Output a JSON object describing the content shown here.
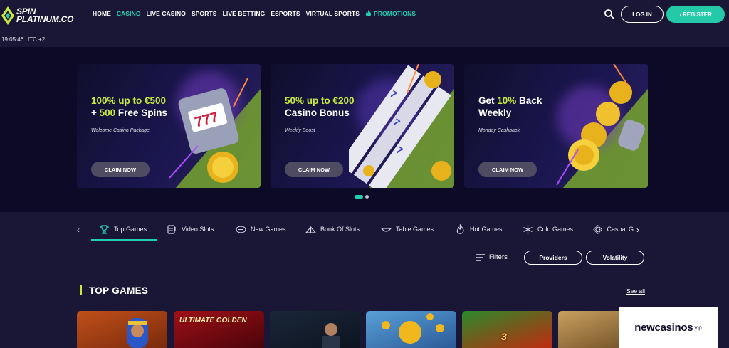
{
  "brand": {
    "line1": "SPIN",
    "line2": "PLATINUM.CO"
  },
  "nav": [
    {
      "label": "HOME",
      "active": false
    },
    {
      "label": "CASINO",
      "active": true
    },
    {
      "label": "LIVE CASINO",
      "active": false
    },
    {
      "label": "SPORTS",
      "active": false
    },
    {
      "label": "LIVE BETTING",
      "active": false
    },
    {
      "label": "ESPORTS",
      "active": false
    },
    {
      "label": "VIRTUAL SPORTS",
      "active": false
    },
    {
      "label": "PROMOTIONS",
      "active": false,
      "icon": "flame-icon"
    }
  ],
  "header": {
    "login": "LOG IN",
    "register": "REGISTER"
  },
  "clock": "19:05:46 UTC +2",
  "promos": [
    {
      "title_hl1": "100% up to €500",
      "title_mid": "+ ",
      "title_hl2": "500",
      "title_end": " Free Spins",
      "subtitle": "Welcome Casino Package",
      "cta": "CLAIM NOW"
    },
    {
      "title_hl1": "50% up to €200",
      "title_line2": "Casino Bonus",
      "subtitle": "Weekly Boost",
      "cta": "CLAIM NOW"
    },
    {
      "title_pre": "Get ",
      "title_hl1": "10%",
      "title_post": " Back",
      "title_line2": "Weekly",
      "subtitle": "Monday Cashback",
      "cta": "CLAIM NOW"
    }
  ],
  "carousel": {
    "active_index": 0,
    "count": 2
  },
  "categories": [
    {
      "label": "Top Games",
      "icon": "trophy-icon"
    },
    {
      "label": "Video Slots",
      "icon": "slot-machine-icon"
    },
    {
      "label": "New Games",
      "icon": "new-badge-icon"
    },
    {
      "label": "Book Of Slots",
      "icon": "book-icon"
    },
    {
      "label": "Table Games",
      "icon": "table-icon"
    },
    {
      "label": "Hot Games",
      "icon": "flame-icon"
    },
    {
      "label": "Cold Games",
      "icon": "snowflake-icon"
    },
    {
      "label": "Casual G",
      "icon": "diamond-icon"
    }
  ],
  "filters": {
    "label": "Filters",
    "providers": "Providers",
    "volatility": "Volatility"
  },
  "section": {
    "title": "TOP GAMES",
    "see_all": "See all"
  },
  "games": [
    {
      "label": ""
    },
    {
      "label": "ULTIMATE GOLDEN"
    },
    {
      "label": ""
    },
    {
      "label": ""
    },
    {
      "label": "3"
    },
    {
      "label": ""
    }
  ],
  "watermark": {
    "brand": "newcasinos",
    "suffix": ".vip"
  },
  "colors": {
    "accent": "#1fd1b0",
    "highlight": "#c7ea3c",
    "background": "#1a1736"
  }
}
